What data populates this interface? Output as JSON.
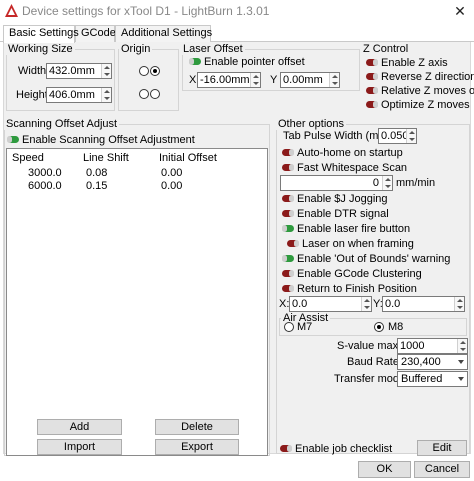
{
  "window": {
    "title": "Device settings for xTool D1 - LightBurn 1.3.01",
    "close": "✕"
  },
  "tabs": [
    "Basic Settings",
    "GCode",
    "Additional Settings"
  ],
  "working_size": {
    "label": "Working Size",
    "width_label": "Width",
    "width_value": "432.0mm",
    "height_label": "Height",
    "height_value": "406.0mm"
  },
  "origin": {
    "label": "Origin",
    "selected_corner": "top-right"
  },
  "laser_offset": {
    "label": "Laser Offset",
    "enable_pointer_offset": {
      "label": "Enable pointer offset",
      "on": true
    },
    "x_label": "X",
    "x_value": "-16.00mm",
    "y_label": "Y",
    "y_value": "0.00mm"
  },
  "z_control": {
    "label": "Z Control",
    "items": [
      {
        "label": "Enable Z axis",
        "on": false
      },
      {
        "label": "Reverse Z direction",
        "on": false
      },
      {
        "label": "Relative Z moves only",
        "on": false
      },
      {
        "label": "Optimize Z moves",
        "on": false
      }
    ]
  },
  "scanning_offset": {
    "label": "Scanning Offset Adjust",
    "enable": {
      "label": "Enable Scanning Offset Adjustment",
      "on": true
    },
    "columns": [
      "Speed",
      "Line Shift",
      "Initial Offset"
    ],
    "rows": [
      [
        "3000.0",
        "0.08",
        "0.00"
      ],
      [
        "6000.0",
        "0.15",
        "0.00"
      ]
    ],
    "add_label": "Add",
    "delete_label": "Delete",
    "import_label": "Import",
    "export_label": "Export"
  },
  "other_options": {
    "label": "Other options",
    "tab_pulse_label": "Tab Pulse Width (ms)",
    "tab_pulse_value": "0.050",
    "auto_home": {
      "label": "Auto-home on startup",
      "on": false
    },
    "fast_whitespace": {
      "label": "Fast Whitespace Scan",
      "on": false
    },
    "fws_value": "0",
    "fws_unit": "mm/min",
    "toggles": [
      {
        "label": "Enable $J Jogging",
        "on": false
      },
      {
        "label": "Enable DTR signal",
        "on": false
      },
      {
        "label": "Enable laser fire button",
        "on": true
      },
      {
        "label": "Laser on when framing",
        "on": false
      },
      {
        "label": "Enable 'Out of Bounds' warning",
        "on": true
      },
      {
        "label": "Enable GCode Clustering",
        "on": false
      },
      {
        "label": "Return to Finish Position",
        "on": false
      }
    ],
    "finish_x_label": "X:",
    "finish_x_value": "0.0",
    "finish_y_label": "Y:",
    "finish_y_value": "0.0"
  },
  "air_assist": {
    "label": "Air Assist",
    "m7_label": "M7",
    "m8_label": "M8",
    "selected": "M8"
  },
  "svalue_label": "S-value max",
  "svalue_value": "1000",
  "baud_label": "Baud Rate",
  "baud_value": "230,400",
  "transfer_label": "Transfer mode",
  "transfer_value": "Buffered",
  "job_checklist": {
    "label": "Enable job checklist",
    "on": false
  },
  "edit_label": "Edit",
  "ok_label": "OK",
  "cancel_label": "Cancel",
  "colors": {
    "toggle_on": "#2e9a3e",
    "toggle_off": "#8b1a1a",
    "panel": "#f0f0f0"
  }
}
